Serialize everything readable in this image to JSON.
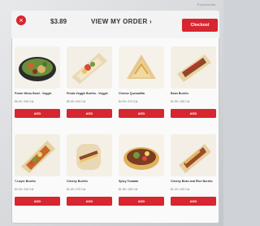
{
  "kiosk": {
    "label": "Placeholder"
  },
  "header": {
    "back_symbol": "×",
    "price": "$3.89",
    "title": "VIEW MY ORDER ›",
    "checkout_label": "Checkout"
  },
  "items": [
    {
      "name": "Power Menu Bowl - Veggie",
      "price": "$6.49 • 450 Cal",
      "add_label": "ADD"
    },
    {
      "name": "Fiesta Veggie Burrito - Veggie",
      "price": "$5.49 • 510 Cal",
      "add_label": "ADD"
    },
    {
      "name": "Cheese Quesadilla",
      "price": "$4.99 • 470 Cal",
      "add_label": "ADD"
    },
    {
      "name": "Bean Burrito",
      "price": "$1.99 • 350 Cal",
      "add_label": "ADD"
    },
    {
      "name": "7-Layer Burrito",
      "price": "$3.49 • 430 Cal",
      "add_label": "ADD"
    },
    {
      "name": "Cheesy Burrito",
      "price": "$2.49 • 370 Cal",
      "add_label": "ADD"
    },
    {
      "name": "Spicy Tostada",
      "price": "$1.89 • 180 Cal",
      "add_label": "ADD"
    },
    {
      "name": "Cheesy Bean and Rice Burrito",
      "price": "$1.29 • 420 Cal",
      "add_label": "ADD"
    }
  ],
  "colors": {
    "accent": "#d7262f",
    "background": "#fafafa"
  }
}
